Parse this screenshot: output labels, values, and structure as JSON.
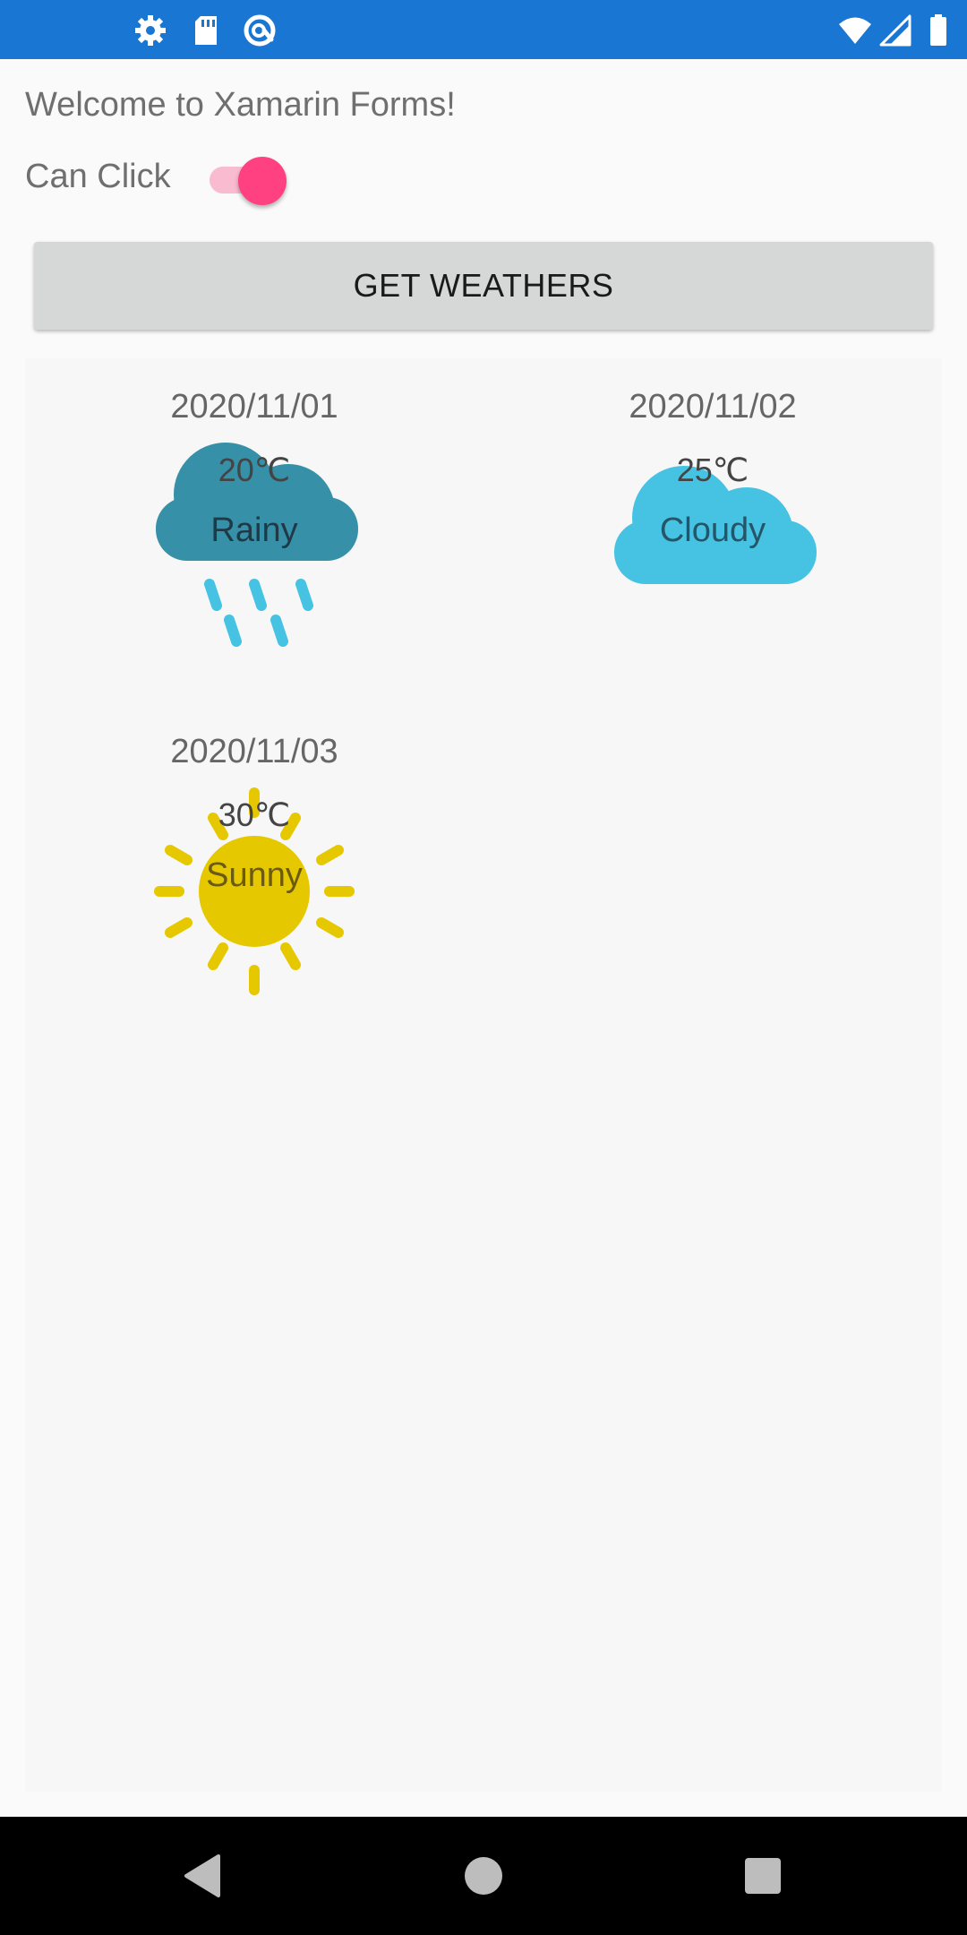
{
  "status_bar": {
    "left_icons": [
      "gear-icon",
      "sd-card-icon",
      "at-sign-icon"
    ],
    "right_icons": [
      "wifi-icon",
      "cell-signal-icon",
      "battery-icon"
    ],
    "color": "#1976d2"
  },
  "header": {
    "welcome_text": "Welcome to Xamarin Forms!",
    "toggle_label": "Can Click",
    "toggle_on": true,
    "toggle_color": "#ff4081"
  },
  "actions": {
    "get_weathers_label": "GET WEATHERS"
  },
  "weathers": [
    {
      "date": "2020/11/01",
      "temperature": "20℃",
      "condition": "Rainy",
      "icon": "rain-cloud-icon",
      "color": "#3690a8"
    },
    {
      "date": "2020/11/02",
      "temperature": "25℃",
      "condition": "Cloudy",
      "icon": "cloud-icon",
      "color": "#46c2e3"
    },
    {
      "date": "2020/11/03",
      "temperature": "30℃",
      "condition": "Sunny",
      "icon": "sun-icon",
      "color": "#e6c800"
    }
  ],
  "nav_bar": {
    "buttons": [
      "back-icon",
      "home-icon",
      "recents-icon"
    ]
  }
}
